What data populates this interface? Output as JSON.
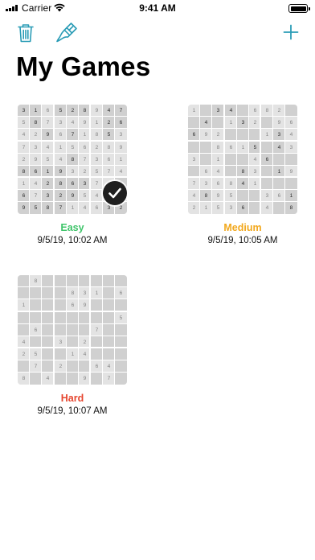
{
  "status_bar": {
    "carrier": "Carrier",
    "time": "9:41 AM"
  },
  "toolbar": {
    "trash_icon": "trash-icon",
    "brush_icon": "paintbrush-icon",
    "add_icon": "plus-icon"
  },
  "colors": {
    "accent": "#2a9cb6",
    "easy": "#3fc46a",
    "medium": "#f2a81d",
    "hard": "#e6462f"
  },
  "page_title": "My Games",
  "games": [
    {
      "difficulty": "Easy",
      "difficulty_color": "#3fc46a",
      "timestamp": "9/5/19, 10:02 AM",
      "completed": true,
      "board": [
        "3_1_6_5_2_8_9_4_7",
        "5_8_7_3_4_9_1_2_6",
        "4_2_9_6_7_1_8_5_3",
        "7_3_4_1_5_6_2_8_9",
        "2_9_5_4_8_7_3_6_1",
        "8_6_1_9_3_2_5_7_4",
        "1_4_2_8_6_3_7_9_5",
        "6_7_3_2_9_5_4_1_8",
        "9_5_8_7_1_4_6_3_2"
      ],
      "given": [
        "110111011",
        "010000011",
        "001010010",
        "000000000",
        "000010000",
        "111100000",
        "001111001",
        "101110000",
        "111100011"
      ]
    },
    {
      "difficulty": "Medium",
      "difficulty_color": "#f2a81d",
      "timestamp": "9/5/19, 10:05 AM",
      "completed": false,
      "board": [
        "1_._3_4_._6_8_2_.",
        "._4_._1_3_2_._9_6",
        "6_9_2_._._._1_3_4",
        "._._8_6_1_5_._4_3",
        "3_._1_._._4_6_._.",
        "._6_4_._8_3_._1_9",
        "7_3_6_8_4_1_._._.",
        "4_8_9_5_._._3_6_1",
        "2_1_5_3_6_._4_._8"
      ],
      "given": [
        "001100000",
        "010010000",
        "100000010",
        "000001010",
        "000000100",
        "000010010",
        "000010000",
        "010000001",
        "000010001"
      ]
    },
    {
      "difficulty": "Hard",
      "difficulty_color": "#e6462f",
      "timestamp": "9/5/19, 10:07 AM",
      "completed": false,
      "board": [
        "._8_._._._._._._.",
        "._._._._8_3_1_._6",
        "1_._._._6_9_._._.",
        "._._._._._._._._5",
        "._6_._._._._7_._.",
        "4_._._3_._2_._._.",
        "2_5_._._1_4_._._.",
        "._7_._2_._._6_4_.",
        "8_._4_._._9_._7_."
      ],
      "given": [
        "000000000",
        "000000000",
        "000000000",
        "000000000",
        "000000000",
        "000000000",
        "000000000",
        "000000000",
        "000000000"
      ]
    }
  ]
}
